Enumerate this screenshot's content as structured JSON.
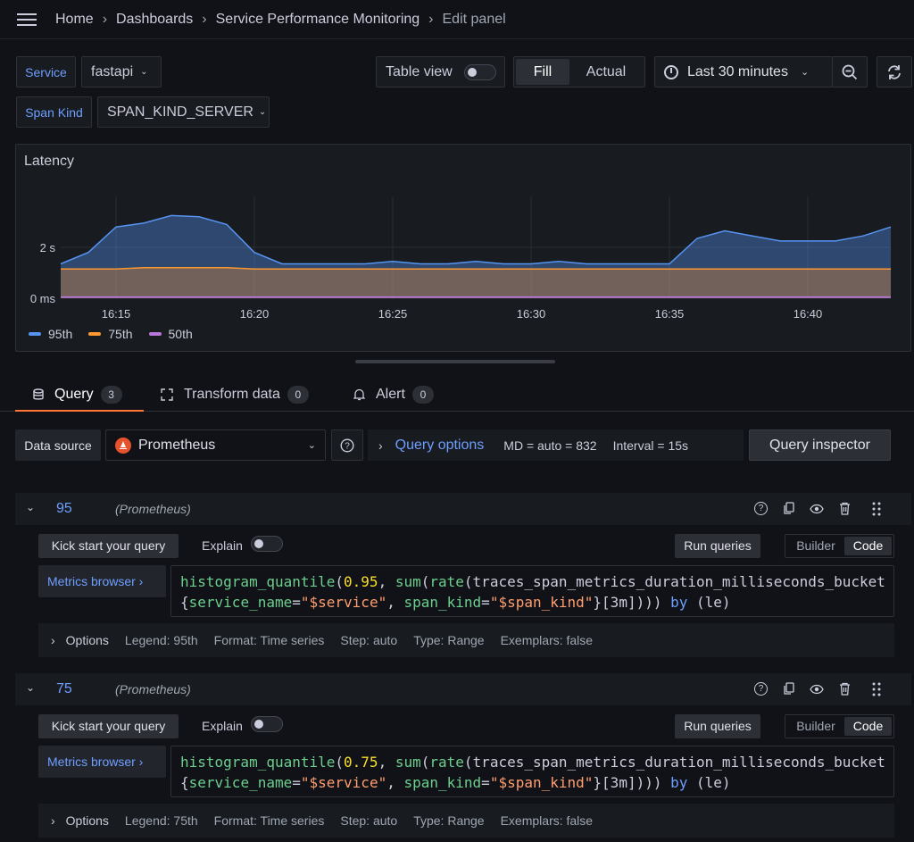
{
  "breadcrumb": {
    "items": [
      "Home",
      "Dashboards",
      "Service Performance Monitoring",
      "Edit panel"
    ],
    "sep": "›"
  },
  "vars": {
    "service_label": "Service",
    "service_value": "fastapi",
    "span_kind_label": "Span Kind",
    "span_kind_value": "SPAN_KIND_SERVER"
  },
  "toolbar": {
    "table_view": "Table view",
    "fill": "Fill",
    "actual": "Actual",
    "time_range": "Last 30 minutes"
  },
  "panel": {
    "title": "Latency"
  },
  "chart_data": {
    "type": "area",
    "title": "Latency",
    "y_ticks": [
      "0 ms",
      "2 s"
    ],
    "x_ticks": [
      "16:15",
      "16:20",
      "16:25",
      "16:30",
      "16:35",
      "16:40"
    ],
    "x": [
      "16:13",
      "16:14",
      "16:15",
      "16:16",
      "16:17",
      "16:18",
      "16:19",
      "16:20",
      "16:21",
      "16:22",
      "16:23",
      "16:24",
      "16:25",
      "16:26",
      "16:27",
      "16:28",
      "16:29",
      "16:30",
      "16:31",
      "16:32",
      "16:33",
      "16:34",
      "16:35",
      "16:36",
      "16:37",
      "16:38",
      "16:39",
      "16:40",
      "16:41",
      "16:42",
      "16:43"
    ],
    "series": [
      {
        "name": "95th",
        "color": "#5794f2",
        "values": [
          1.35,
          1.8,
          2.8,
          2.95,
          3.25,
          3.2,
          2.9,
          1.8,
          1.35,
          1.35,
          1.35,
          1.35,
          1.45,
          1.35,
          1.35,
          1.45,
          1.35,
          1.35,
          1.45,
          1.35,
          1.35,
          1.35,
          1.35,
          2.35,
          2.65,
          2.45,
          2.25,
          2.25,
          2.25,
          2.45,
          2.8
        ]
      },
      {
        "name": "75th",
        "color": "#ff9830",
        "values": [
          1.15,
          1.15,
          1.15,
          1.2,
          1.2,
          1.2,
          1.2,
          1.15,
          1.15,
          1.15,
          1.15,
          1.15,
          1.15,
          1.15,
          1.15,
          1.15,
          1.15,
          1.15,
          1.15,
          1.15,
          1.15,
          1.15,
          1.15,
          1.15,
          1.15,
          1.15,
          1.15,
          1.15,
          1.15,
          1.15,
          1.15
        ]
      },
      {
        "name": "50th",
        "color": "#b877d9",
        "values": [
          0.05,
          0.05,
          0.05,
          0.05,
          0.05,
          0.05,
          0.05,
          0.05,
          0.05,
          0.05,
          0.05,
          0.05,
          0.05,
          0.05,
          0.05,
          0.05,
          0.05,
          0.05,
          0.05,
          0.05,
          0.05,
          0.05,
          0.05,
          0.05,
          0.05,
          0.05,
          0.05,
          0.05,
          0.05,
          0.05,
          0.05
        ]
      }
    ],
    "ylim": [
      0,
      4
    ]
  },
  "tabs": [
    {
      "label": "Query",
      "count": "3"
    },
    {
      "label": "Transform data",
      "count": "0"
    },
    {
      "label": "Alert",
      "count": "0"
    }
  ],
  "datasource": {
    "label": "Data source",
    "value": "Prometheus",
    "query_options": "Query options",
    "md": "MD = auto = 832",
    "interval": "Interval = 15s",
    "inspector": "Query inspector"
  },
  "queries": [
    {
      "ref": "95",
      "ds": "(Prometheus)",
      "kick": "Kick start your query",
      "explain": "Explain",
      "run": "Run queries",
      "builder": "Builder",
      "code": "Code",
      "metrics": "Metrics browser ›",
      "line1": {
        "fn": "histogram_quantile",
        "open": "(",
        "num": "0.95",
        "c1": ", ",
        "sum": "sum",
        "p1": "(",
        "rate": "rate",
        "p2": "(",
        "metric": "traces_span_metrics_duration_milliseconds_bucket"
      },
      "line2": {
        "b1": "{",
        "k1": "service_name",
        "eq1": "=",
        "v1": "\"$service\"",
        "c": ", ",
        "k2": "span_kind",
        "eq2": "=",
        "v2": "\"$span_kind\"",
        "b2": "}",
        "range": "[3m]",
        "close": ")))",
        "by": " by ",
        "le": "(le)"
      },
      "options": "Options",
      "legend": "Legend: 95th",
      "format": "Format: Time series",
      "step": "Step: auto",
      "type": "Type: Range",
      "exemplars": "Exemplars: false"
    },
    {
      "ref": "75",
      "ds": "(Prometheus)",
      "kick": "Kick start your query",
      "explain": "Explain",
      "run": "Run queries",
      "builder": "Builder",
      "code": "Code",
      "metrics": "Metrics browser ›",
      "line1": {
        "fn": "histogram_quantile",
        "open": "(",
        "num": "0.75",
        "c1": ", ",
        "sum": "sum",
        "p1": "(",
        "rate": "rate",
        "p2": "(",
        "metric": "traces_span_metrics_duration_milliseconds_bucket"
      },
      "line2": {
        "b1": "{",
        "k1": "service_name",
        "eq1": "=",
        "v1": "\"$service\"",
        "c": ", ",
        "k2": "span_kind",
        "eq2": "=",
        "v2": "\"$span_kind\"",
        "b2": "}",
        "range": "[3m]",
        "close": ")))",
        "by": " by ",
        "le": "(le)"
      },
      "options": "Options",
      "legend": "Legend: 75th",
      "format": "Format: Time series",
      "step": "Step: auto",
      "type": "Type: Range",
      "exemplars": "Exemplars: false"
    }
  ]
}
